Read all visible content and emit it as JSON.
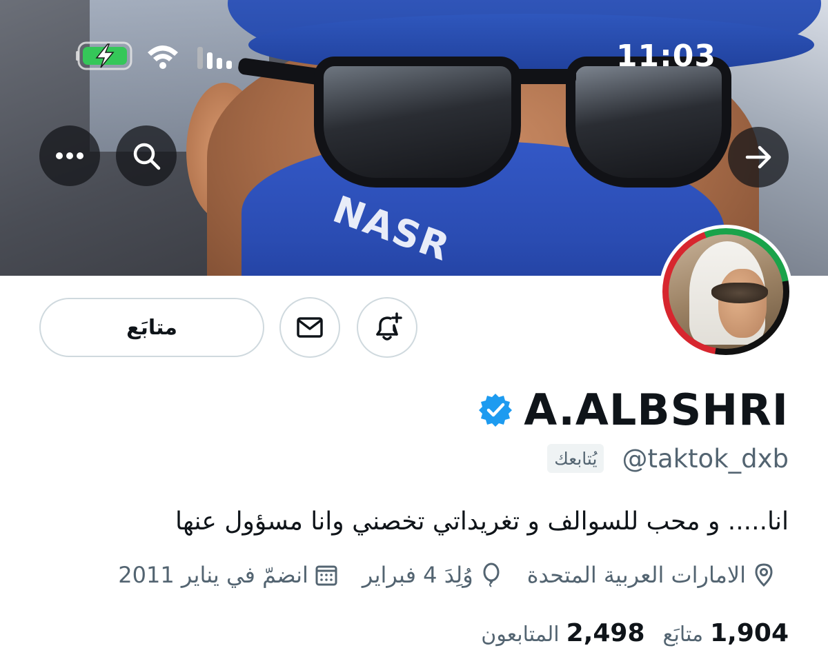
{
  "status_bar": {
    "time": "11:03",
    "icons": [
      "battery-charging-icon",
      "wifi-icon",
      "cellular-signal-icon"
    ]
  },
  "banner": {
    "more_button_icon": "ellipsis-icon",
    "search_button_icon": "search-icon",
    "back_button_icon": "arrow-right-icon",
    "mask_text": "NASR"
  },
  "actions": {
    "follow_label": "متابَع",
    "message_icon": "envelope-icon",
    "notify_icon": "bell-plus-icon"
  },
  "profile": {
    "display_name": "A.ALBSHRI",
    "verified": true,
    "handle": "@taktok_dxb",
    "follows_you": "يُتابعك",
    "bio": "انا..... و محب للسوالف و تغريداتي تخصني وانا مسؤول عنها",
    "location": "الامارات العربية المتحدة",
    "birthday": "وُلِدَ 4 فبراير",
    "joined": "انضمّ في يناير 2011"
  },
  "stats": {
    "following_count": "1,904",
    "following_label": "متابَع",
    "followers_count": "2,498",
    "followers_label": "المتابعون"
  },
  "colors": {
    "verified_blue": "#1d9bf0",
    "secondary_text": "#536471",
    "border": "#cfd9de",
    "primary_text": "#0f1419"
  }
}
